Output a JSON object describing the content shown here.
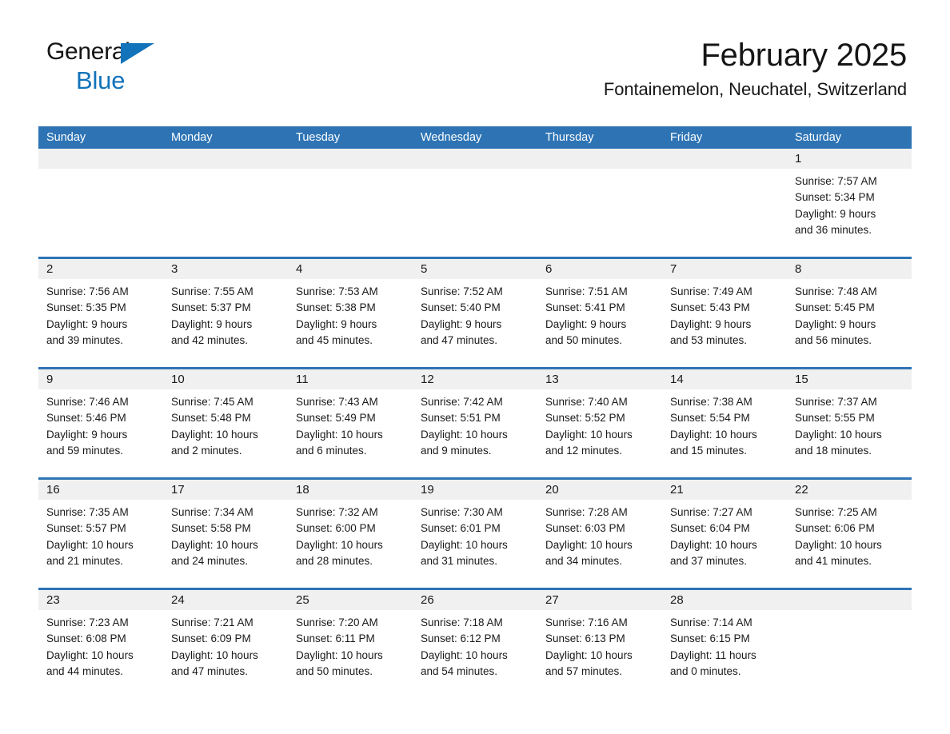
{
  "brand": {
    "name_part1": "General",
    "name_part2": "Blue",
    "triangle_icon": "triangle-icon",
    "accent_color": "#1273ba"
  },
  "header": {
    "title": "February 2025",
    "subtitle": "Fontainemelon, Neuchatel, Switzerland",
    "header_bg_color": "#2e74b5",
    "daynum_bg_color": "#f0f0f0"
  },
  "weekdays": [
    "Sunday",
    "Monday",
    "Tuesday",
    "Wednesday",
    "Thursday",
    "Friday",
    "Saturday"
  ],
  "calendar": {
    "month": "February",
    "year": "2025",
    "weeks": [
      [
        {
          "day": "",
          "sunrise": "",
          "sunset": "",
          "daylight_line1": "",
          "daylight_line2": "",
          "empty": true
        },
        {
          "day": "",
          "sunrise": "",
          "sunset": "",
          "daylight_line1": "",
          "daylight_line2": "",
          "empty": true
        },
        {
          "day": "",
          "sunrise": "",
          "sunset": "",
          "daylight_line1": "",
          "daylight_line2": "",
          "empty": true
        },
        {
          "day": "",
          "sunrise": "",
          "sunset": "",
          "daylight_line1": "",
          "daylight_line2": "",
          "empty": true
        },
        {
          "day": "",
          "sunrise": "",
          "sunset": "",
          "daylight_line1": "",
          "daylight_line2": "",
          "empty": true
        },
        {
          "day": "",
          "sunrise": "",
          "sunset": "",
          "daylight_line1": "",
          "daylight_line2": "",
          "empty": true
        },
        {
          "day": "1",
          "sunrise": "Sunrise: 7:57 AM",
          "sunset": "Sunset: 5:34 PM",
          "daylight_line1": "Daylight: 9 hours",
          "daylight_line2": "and 36 minutes.",
          "empty": false
        }
      ],
      [
        {
          "day": "2",
          "sunrise": "Sunrise: 7:56 AM",
          "sunset": "Sunset: 5:35 PM",
          "daylight_line1": "Daylight: 9 hours",
          "daylight_line2": "and 39 minutes.",
          "empty": false
        },
        {
          "day": "3",
          "sunrise": "Sunrise: 7:55 AM",
          "sunset": "Sunset: 5:37 PM",
          "daylight_line1": "Daylight: 9 hours",
          "daylight_line2": "and 42 minutes.",
          "empty": false
        },
        {
          "day": "4",
          "sunrise": "Sunrise: 7:53 AM",
          "sunset": "Sunset: 5:38 PM",
          "daylight_line1": "Daylight: 9 hours",
          "daylight_line2": "and 45 minutes.",
          "empty": false
        },
        {
          "day": "5",
          "sunrise": "Sunrise: 7:52 AM",
          "sunset": "Sunset: 5:40 PM",
          "daylight_line1": "Daylight: 9 hours",
          "daylight_line2": "and 47 minutes.",
          "empty": false
        },
        {
          "day": "6",
          "sunrise": "Sunrise: 7:51 AM",
          "sunset": "Sunset: 5:41 PM",
          "daylight_line1": "Daylight: 9 hours",
          "daylight_line2": "and 50 minutes.",
          "empty": false
        },
        {
          "day": "7",
          "sunrise": "Sunrise: 7:49 AM",
          "sunset": "Sunset: 5:43 PM",
          "daylight_line1": "Daylight: 9 hours",
          "daylight_line2": "and 53 minutes.",
          "empty": false
        },
        {
          "day": "8",
          "sunrise": "Sunrise: 7:48 AM",
          "sunset": "Sunset: 5:45 PM",
          "daylight_line1": "Daylight: 9 hours",
          "daylight_line2": "and 56 minutes.",
          "empty": false
        }
      ],
      [
        {
          "day": "9",
          "sunrise": "Sunrise: 7:46 AM",
          "sunset": "Sunset: 5:46 PM",
          "daylight_line1": "Daylight: 9 hours",
          "daylight_line2": "and 59 minutes.",
          "empty": false
        },
        {
          "day": "10",
          "sunrise": "Sunrise: 7:45 AM",
          "sunset": "Sunset: 5:48 PM",
          "daylight_line1": "Daylight: 10 hours",
          "daylight_line2": "and 2 minutes.",
          "empty": false
        },
        {
          "day": "11",
          "sunrise": "Sunrise: 7:43 AM",
          "sunset": "Sunset: 5:49 PM",
          "daylight_line1": "Daylight: 10 hours",
          "daylight_line2": "and 6 minutes.",
          "empty": false
        },
        {
          "day": "12",
          "sunrise": "Sunrise: 7:42 AM",
          "sunset": "Sunset: 5:51 PM",
          "daylight_line1": "Daylight: 10 hours",
          "daylight_line2": "and 9 minutes.",
          "empty": false
        },
        {
          "day": "13",
          "sunrise": "Sunrise: 7:40 AM",
          "sunset": "Sunset: 5:52 PM",
          "daylight_line1": "Daylight: 10 hours",
          "daylight_line2": "and 12 minutes.",
          "empty": false
        },
        {
          "day": "14",
          "sunrise": "Sunrise: 7:38 AM",
          "sunset": "Sunset: 5:54 PM",
          "daylight_line1": "Daylight: 10 hours",
          "daylight_line2": "and 15 minutes.",
          "empty": false
        },
        {
          "day": "15",
          "sunrise": "Sunrise: 7:37 AM",
          "sunset": "Sunset: 5:55 PM",
          "daylight_line1": "Daylight: 10 hours",
          "daylight_line2": "and 18 minutes.",
          "empty": false
        }
      ],
      [
        {
          "day": "16",
          "sunrise": "Sunrise: 7:35 AM",
          "sunset": "Sunset: 5:57 PM",
          "daylight_line1": "Daylight: 10 hours",
          "daylight_line2": "and 21 minutes.",
          "empty": false
        },
        {
          "day": "17",
          "sunrise": "Sunrise: 7:34 AM",
          "sunset": "Sunset: 5:58 PM",
          "daylight_line1": "Daylight: 10 hours",
          "daylight_line2": "and 24 minutes.",
          "empty": false
        },
        {
          "day": "18",
          "sunrise": "Sunrise: 7:32 AM",
          "sunset": "Sunset: 6:00 PM",
          "daylight_line1": "Daylight: 10 hours",
          "daylight_line2": "and 28 minutes.",
          "empty": false
        },
        {
          "day": "19",
          "sunrise": "Sunrise: 7:30 AM",
          "sunset": "Sunset: 6:01 PM",
          "daylight_line1": "Daylight: 10 hours",
          "daylight_line2": "and 31 minutes.",
          "empty": false
        },
        {
          "day": "20",
          "sunrise": "Sunrise: 7:28 AM",
          "sunset": "Sunset: 6:03 PM",
          "daylight_line1": "Daylight: 10 hours",
          "daylight_line2": "and 34 minutes.",
          "empty": false
        },
        {
          "day": "21",
          "sunrise": "Sunrise: 7:27 AM",
          "sunset": "Sunset: 6:04 PM",
          "daylight_line1": "Daylight: 10 hours",
          "daylight_line2": "and 37 minutes.",
          "empty": false
        },
        {
          "day": "22",
          "sunrise": "Sunrise: 7:25 AM",
          "sunset": "Sunset: 6:06 PM",
          "daylight_line1": "Daylight: 10 hours",
          "daylight_line2": "and 41 minutes.",
          "empty": false
        }
      ],
      [
        {
          "day": "23",
          "sunrise": "Sunrise: 7:23 AM",
          "sunset": "Sunset: 6:08 PM",
          "daylight_line1": "Daylight: 10 hours",
          "daylight_line2": "and 44 minutes.",
          "empty": false
        },
        {
          "day": "24",
          "sunrise": "Sunrise: 7:21 AM",
          "sunset": "Sunset: 6:09 PM",
          "daylight_line1": "Daylight: 10 hours",
          "daylight_line2": "and 47 minutes.",
          "empty": false
        },
        {
          "day": "25",
          "sunrise": "Sunrise: 7:20 AM",
          "sunset": "Sunset: 6:11 PM",
          "daylight_line1": "Daylight: 10 hours",
          "daylight_line2": "and 50 minutes.",
          "empty": false
        },
        {
          "day": "26",
          "sunrise": "Sunrise: 7:18 AM",
          "sunset": "Sunset: 6:12 PM",
          "daylight_line1": "Daylight: 10 hours",
          "daylight_line2": "and 54 minutes.",
          "empty": false
        },
        {
          "day": "27",
          "sunrise": "Sunrise: 7:16 AM",
          "sunset": "Sunset: 6:13 PM",
          "daylight_line1": "Daylight: 10 hours",
          "daylight_line2": "and 57 minutes.",
          "empty": false
        },
        {
          "day": "28",
          "sunrise": "Sunrise: 7:14 AM",
          "sunset": "Sunset: 6:15 PM",
          "daylight_line1": "Daylight: 11 hours",
          "daylight_line2": "and 0 minutes.",
          "empty": false
        },
        {
          "day": "",
          "sunrise": "",
          "sunset": "",
          "daylight_line1": "",
          "daylight_line2": "",
          "empty": true
        }
      ]
    ]
  }
}
